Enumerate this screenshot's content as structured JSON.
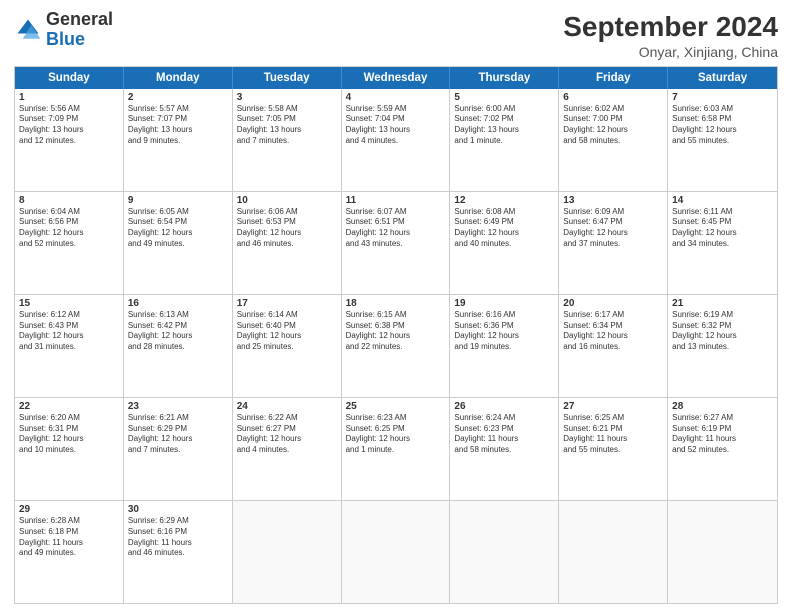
{
  "header": {
    "logo_general": "General",
    "logo_blue": "Blue",
    "title": "September 2024",
    "subtitle": "Onyar, Xinjiang, China"
  },
  "days": [
    "Sunday",
    "Monday",
    "Tuesday",
    "Wednesday",
    "Thursday",
    "Friday",
    "Saturday"
  ],
  "weeks": [
    [
      {
        "day": "1",
        "sunrise": "5:56 AM",
        "sunset": "7:09 PM",
        "daylight": "13 hours and 12 minutes."
      },
      {
        "day": "2",
        "sunrise": "5:57 AM",
        "sunset": "7:07 PM",
        "daylight": "13 hours and 9 minutes."
      },
      {
        "day": "3",
        "sunrise": "5:58 AM",
        "sunset": "7:05 PM",
        "daylight": "13 hours and 7 minutes."
      },
      {
        "day": "4",
        "sunrise": "5:59 AM",
        "sunset": "7:04 PM",
        "daylight": "13 hours and 4 minutes."
      },
      {
        "day": "5",
        "sunrise": "6:00 AM",
        "sunset": "7:02 PM",
        "daylight": "13 hours and 1 minute."
      },
      {
        "day": "6",
        "sunrise": "6:02 AM",
        "sunset": "7:00 PM",
        "daylight": "12 hours and 58 minutes."
      },
      {
        "day": "7",
        "sunrise": "6:03 AM",
        "sunset": "6:58 PM",
        "daylight": "12 hours and 55 minutes."
      }
    ],
    [
      {
        "day": "8",
        "sunrise": "6:04 AM",
        "sunset": "6:56 PM",
        "daylight": "12 hours and 52 minutes."
      },
      {
        "day": "9",
        "sunrise": "6:05 AM",
        "sunset": "6:54 PM",
        "daylight": "12 hours and 49 minutes."
      },
      {
        "day": "10",
        "sunrise": "6:06 AM",
        "sunset": "6:53 PM",
        "daylight": "12 hours and 46 minutes."
      },
      {
        "day": "11",
        "sunrise": "6:07 AM",
        "sunset": "6:51 PM",
        "daylight": "12 hours and 43 minutes."
      },
      {
        "day": "12",
        "sunrise": "6:08 AM",
        "sunset": "6:49 PM",
        "daylight": "12 hours and 40 minutes."
      },
      {
        "day": "13",
        "sunrise": "6:09 AM",
        "sunset": "6:47 PM",
        "daylight": "12 hours and 37 minutes."
      },
      {
        "day": "14",
        "sunrise": "6:11 AM",
        "sunset": "6:45 PM",
        "daylight": "12 hours and 34 minutes."
      }
    ],
    [
      {
        "day": "15",
        "sunrise": "6:12 AM",
        "sunset": "6:43 PM",
        "daylight": "12 hours and 31 minutes."
      },
      {
        "day": "16",
        "sunrise": "6:13 AM",
        "sunset": "6:42 PM",
        "daylight": "12 hours and 28 minutes."
      },
      {
        "day": "17",
        "sunrise": "6:14 AM",
        "sunset": "6:40 PM",
        "daylight": "12 hours and 25 minutes."
      },
      {
        "day": "18",
        "sunrise": "6:15 AM",
        "sunset": "6:38 PM",
        "daylight": "12 hours and 22 minutes."
      },
      {
        "day": "19",
        "sunrise": "6:16 AM",
        "sunset": "6:36 PM",
        "daylight": "12 hours and 19 minutes."
      },
      {
        "day": "20",
        "sunrise": "6:17 AM",
        "sunset": "6:34 PM",
        "daylight": "12 hours and 16 minutes."
      },
      {
        "day": "21",
        "sunrise": "6:19 AM",
        "sunset": "6:32 PM",
        "daylight": "12 hours and 13 minutes."
      }
    ],
    [
      {
        "day": "22",
        "sunrise": "6:20 AM",
        "sunset": "6:31 PM",
        "daylight": "12 hours and 10 minutes."
      },
      {
        "day": "23",
        "sunrise": "6:21 AM",
        "sunset": "6:29 PM",
        "daylight": "12 hours and 7 minutes."
      },
      {
        "day": "24",
        "sunrise": "6:22 AM",
        "sunset": "6:27 PM",
        "daylight": "12 hours and 4 minutes."
      },
      {
        "day": "25",
        "sunrise": "6:23 AM",
        "sunset": "6:25 PM",
        "daylight": "12 hours and 1 minute."
      },
      {
        "day": "26",
        "sunrise": "6:24 AM",
        "sunset": "6:23 PM",
        "daylight": "11 hours and 58 minutes."
      },
      {
        "day": "27",
        "sunrise": "6:25 AM",
        "sunset": "6:21 PM",
        "daylight": "11 hours and 55 minutes."
      },
      {
        "day": "28",
        "sunrise": "6:27 AM",
        "sunset": "6:19 PM",
        "daylight": "11 hours and 52 minutes."
      }
    ],
    [
      {
        "day": "29",
        "sunrise": "6:28 AM",
        "sunset": "6:18 PM",
        "daylight": "11 hours and 49 minutes."
      },
      {
        "day": "30",
        "sunrise": "6:29 AM",
        "sunset": "6:16 PM",
        "daylight": "11 hours and 46 minutes."
      },
      null,
      null,
      null,
      null,
      null
    ]
  ]
}
